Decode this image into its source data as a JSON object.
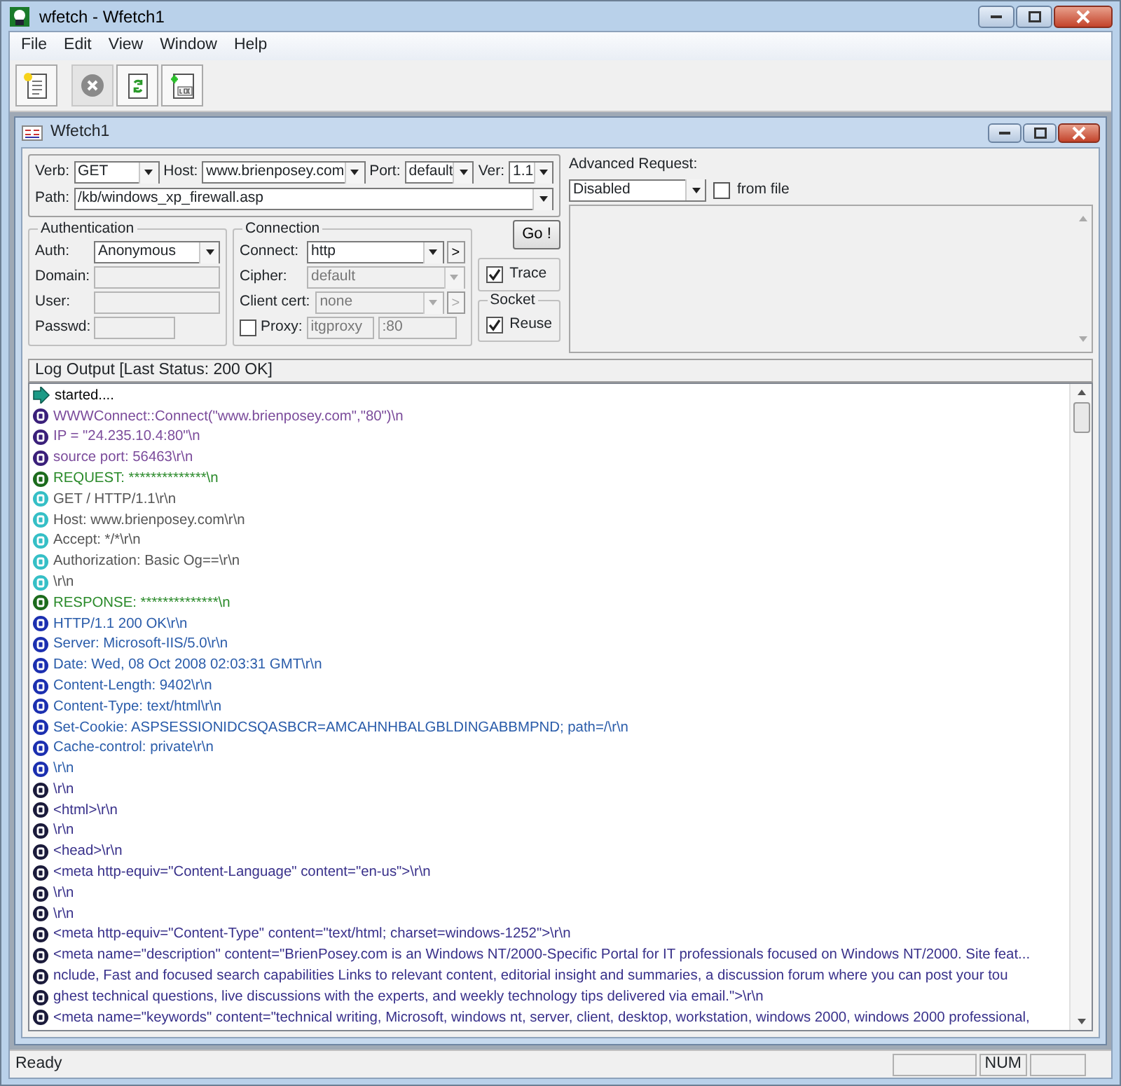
{
  "window": {
    "title": "wfetch - Wfetch1"
  },
  "menu": [
    "File",
    "Edit",
    "View",
    "Window",
    "Help"
  ],
  "toolbar": [
    {
      "kind": "new",
      "disabled": false
    },
    {
      "kind": "stop",
      "disabled": true
    },
    {
      "kind": "refresh",
      "disabled": false
    },
    {
      "kind": "log",
      "disabled": false
    }
  ],
  "child_window": {
    "title": "Wfetch1"
  },
  "request": {
    "verb": {
      "label": "Verb:",
      "value": "GET"
    },
    "host": {
      "label": "Host:",
      "value": "www.brienposey.com"
    },
    "port": {
      "label": "Port:",
      "value": "default"
    },
    "version": {
      "label": "Ver:",
      "value": "1.1"
    },
    "path": {
      "label": "Path:",
      "value": "/kb/windows_xp_firewall.asp"
    }
  },
  "authentication": {
    "title": "Authentication",
    "fields": [
      {
        "label": "Auth:",
        "kind": "select",
        "value": "Anonymous",
        "disabled": false
      },
      {
        "label": "Domain:",
        "kind": "input",
        "disabled": true
      },
      {
        "label": "User:",
        "kind": "input",
        "disabled": true
      },
      {
        "label": "Passwd:",
        "kind": "short",
        "disabled": true
      }
    ]
  },
  "connection": {
    "title": "Connection",
    "fields": [
      {
        "label": "Connect:",
        "value": "http",
        "disabled": false,
        "more": ">"
      },
      {
        "label": "Cipher:",
        "value": "default",
        "disabled": true
      },
      {
        "label": "Client cert:",
        "value": "none",
        "disabled": true,
        "more": ">"
      }
    ],
    "proxy": {
      "label": "Proxy:",
      "checked": false,
      "host": "itgproxy",
      "port": ":80"
    }
  },
  "go_button": "Go !",
  "trace": {
    "label": "Trace",
    "checked": true
  },
  "socket": {
    "title": "Socket",
    "label": "Reuse",
    "checked": true
  },
  "advanced": {
    "label": "Advanced Request:",
    "value": "Disabled",
    "from_file": {
      "label": "from file",
      "checked": false
    }
  },
  "log": {
    "title": "Log Output [Last Status: 200 OK]",
    "lines": [
      {
        "kind": "start",
        "text": "started...."
      },
      {
        "kind": "S",
        "text": "WWWConnect::Connect(\"www.brienposey.com\",\"80\")\\n"
      },
      {
        "kind": "S",
        "text": "IP = \"24.235.10.4:80\"\\n"
      },
      {
        "kind": "S",
        "text": "source port: 56463\\r\\n"
      },
      {
        "kind": "I",
        "text": "REQUEST: **************\\n"
      },
      {
        "kind": "R",
        "text": "GET / HTTP/1.1\\r\\n"
      },
      {
        "kind": "R",
        "text": "Host: www.brienposey.com\\r\\n"
      },
      {
        "kind": "R",
        "text": "Accept: */*\\r\\n"
      },
      {
        "kind": "R",
        "text": "Authorization: Basic Og==\\r\\n"
      },
      {
        "kind": "R",
        "text": "\\r\\n"
      },
      {
        "kind": "I",
        "text": "RESPONSE: **************\\n"
      },
      {
        "kind": "H",
        "text": "HTTP/1.1 200 OK\\r\\n"
      },
      {
        "kind": "H",
        "text": "Server: Microsoft-IIS/5.0\\r\\n"
      },
      {
        "kind": "H",
        "text": "Date: Wed, 08 Oct 2008 02:03:31 GMT\\r\\n"
      },
      {
        "kind": "H",
        "text": "Content-Length: 9402\\r\\n"
      },
      {
        "kind": "H",
        "text": "Content-Type: text/html\\r\\n"
      },
      {
        "kind": "H",
        "text": "Set-Cookie: ASPSESSIONIDCSQASBCR=AMCAHNHBALGBLDINGABBMPND; path=/\\r\\n"
      },
      {
        "kind": "H",
        "text": "Cache-control: private\\r\\n"
      },
      {
        "kind": "H",
        "text": "\\r\\n"
      },
      {
        "kind": "D",
        "text": "\\r\\n"
      },
      {
        "kind": "D",
        "text": "<html>\\r\\n"
      },
      {
        "kind": "D",
        "text": "\\r\\n"
      },
      {
        "kind": "D",
        "text": "<head>\\r\\n"
      },
      {
        "kind": "D",
        "text": "<meta http-equiv=\"Content-Language\" content=\"en-us\">\\r\\n"
      },
      {
        "kind": "D",
        "text": " \\r\\n"
      },
      {
        "kind": "D",
        "text": " \\r\\n"
      },
      {
        "kind": "D",
        "text": "<meta http-equiv=\"Content-Type\" content=\"text/html; charset=windows-1252\">\\r\\n"
      },
      {
        "kind": "D",
        "text": "<meta name=\"description\" content=\"BrienPosey.com is an Windows NT/2000-Specific Portal for IT professionals focused on Windows NT/2000. Site feat..."
      },
      {
        "kind": "D",
        "text": "nclude, Fast and focused search capabilities Links to relevant content, editorial insight and summaries, a discussion forum where you can post your tou"
      },
      {
        "kind": "D",
        "text": "ghest technical questions, live discussions with the experts, and weekly technology tips delivered via email.\">\\r\\n"
      },
      {
        "kind": "D",
        "text": "<meta name=\"keywords\" content=\"technical writing, Microsoft, windows nt, server, client, desktop, workstation, windows 2000, windows 2000 professional,"
      }
    ]
  },
  "status_bar": {
    "text": "Ready",
    "panes": [
      "NUM"
    ]
  }
}
